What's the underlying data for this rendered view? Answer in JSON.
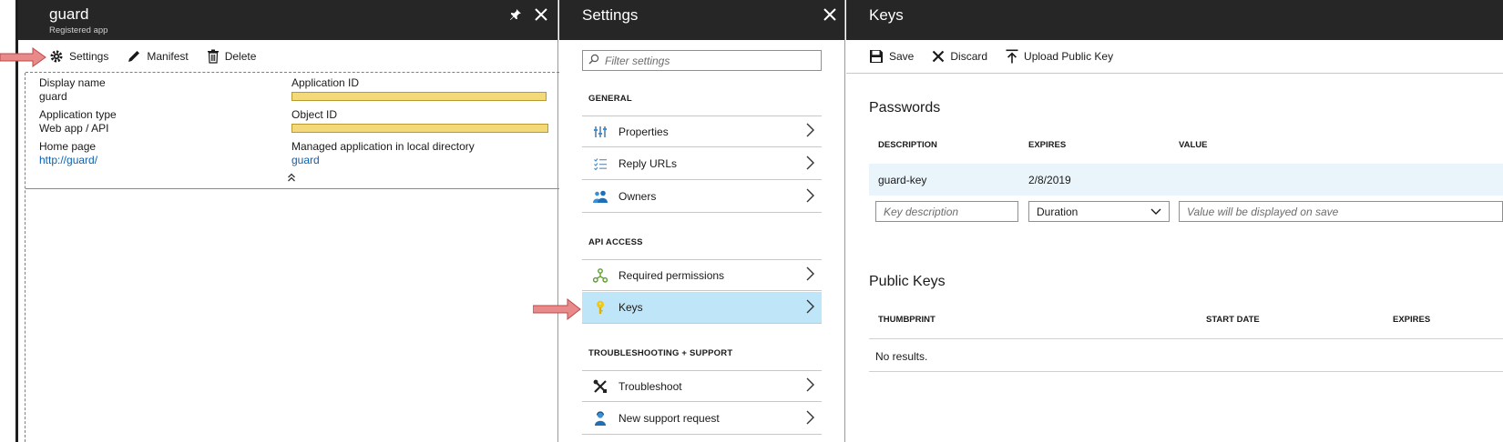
{
  "guard_blade": {
    "title": "guard",
    "subtitle": "Registered app",
    "pin_icon": "pin-icon",
    "close_icon": "close-icon",
    "toolbar": {
      "settings": "Settings",
      "manifest": "Manifest",
      "delete": "Delete"
    },
    "essentials": {
      "display_name_label": "Display name",
      "display_name_value": "guard",
      "application_type_label": "Application type",
      "application_type_value": "Web app / API",
      "home_page_label": "Home page",
      "home_page_value": "http://guard/",
      "application_id_label": "Application ID",
      "object_id_label": "Object ID",
      "managed_app_label": "Managed application in local directory",
      "managed_app_value": "guard"
    }
  },
  "settings_blade": {
    "title": "Settings",
    "filter_placeholder": "Filter settings",
    "sections": {
      "general": "GENERAL",
      "api_access": "API ACCESS",
      "troubleshooting": "TROUBLESHOOTING + SUPPORT"
    },
    "items": {
      "properties": "Properties",
      "reply_urls": "Reply URLs",
      "owners": "Owners",
      "required_permissions": "Required permissions",
      "keys": "Keys",
      "troubleshoot": "Troubleshoot",
      "new_support_request": "New support request"
    }
  },
  "keys_blade": {
    "title": "Keys",
    "toolbar": {
      "save": "Save",
      "discard": "Discard",
      "upload_public_key": "Upload Public Key"
    },
    "passwords": {
      "heading": "Passwords",
      "columns": [
        "DESCRIPTION",
        "EXPIRES",
        "VALUE"
      ],
      "row": {
        "description": "guard-key",
        "expires": "2/8/2019"
      },
      "new_row": {
        "description_placeholder": "Key description",
        "duration_value": "Duration",
        "value_placeholder": "Value will be displayed on save"
      }
    },
    "public_keys": {
      "heading": "Public Keys",
      "columns": [
        "THUMBPRINT",
        "START DATE",
        "EXPIRES"
      ],
      "empty": "No results."
    }
  },
  "colors": {
    "header_bg": "#262626",
    "selected_item": "#bfe6f8",
    "link": "#0b61b2",
    "redacted_bar": "#f4d97a",
    "annotation_arrow": "#e88a8a"
  }
}
